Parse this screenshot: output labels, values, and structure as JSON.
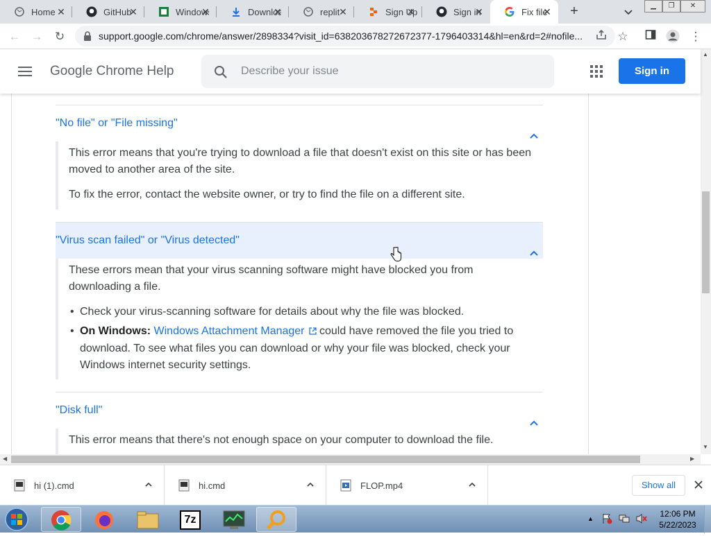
{
  "browser": {
    "tabs": [
      {
        "label": "Home",
        "icon": "globe-icon"
      },
      {
        "label": "GitHub",
        "icon": "github-icon"
      },
      {
        "label": "Windows",
        "icon": "sheet-icon"
      },
      {
        "label": "Downloads",
        "icon": "download-icon"
      },
      {
        "label": "replit",
        "icon": "globe-icon"
      },
      {
        "label": "Sign Up",
        "icon": "replit-icon"
      },
      {
        "label": "Sign in",
        "icon": "github-icon"
      },
      {
        "label": "Fix file",
        "icon": "google-icon"
      }
    ],
    "url": "support.google.com/chrome/answer/2898334?visit_id=638203678272672377-1796403314&hl=en&rd=2#nofile..."
  },
  "header": {
    "title": "Google Chrome Help",
    "search_placeholder": "Describe your issue",
    "sign_in": "Sign in"
  },
  "sections": [
    {
      "title": "\"No file\" or \"File missing\"",
      "paragraphs": [
        "This error means that you're trying to download a file that doesn't exist on this site or has been moved to another area of the site.",
        "To fix the error, contact the website owner, or try to find the file on a different site."
      ]
    },
    {
      "title": "\"Virus scan failed\" or \"Virus detected\"",
      "paragraphs": [
        "These errors mean that your virus scanning software might have blocked you from downloading a file."
      ],
      "bullets": [
        {
          "text": "Check your virus-scanning software for details about why the file was blocked."
        },
        {
          "bold": "On Windows:",
          "link": "Windows Attachment Manager",
          "text": " could have removed the file you tried to download. To see what files you can download or why your file was blocked, check your Windows internet security settings."
        }
      ]
    },
    {
      "title": "\"Disk full\"",
      "paragraphs": [
        "This error means that there's not enough space on your computer to download the file."
      ]
    }
  ],
  "downloads": {
    "items": [
      {
        "name": "hi (1).cmd"
      },
      {
        "name": "hi.cmd"
      },
      {
        "name": "FLOP.mp4"
      }
    ],
    "show_all": "Show all"
  },
  "taskbar": {
    "time": "12:06 PM",
    "date": "5/22/2023"
  },
  "colors": {
    "accent": "#1a73e8",
    "tab_bar": "#dee1e6",
    "highlight_row": "#e8f0fe"
  }
}
